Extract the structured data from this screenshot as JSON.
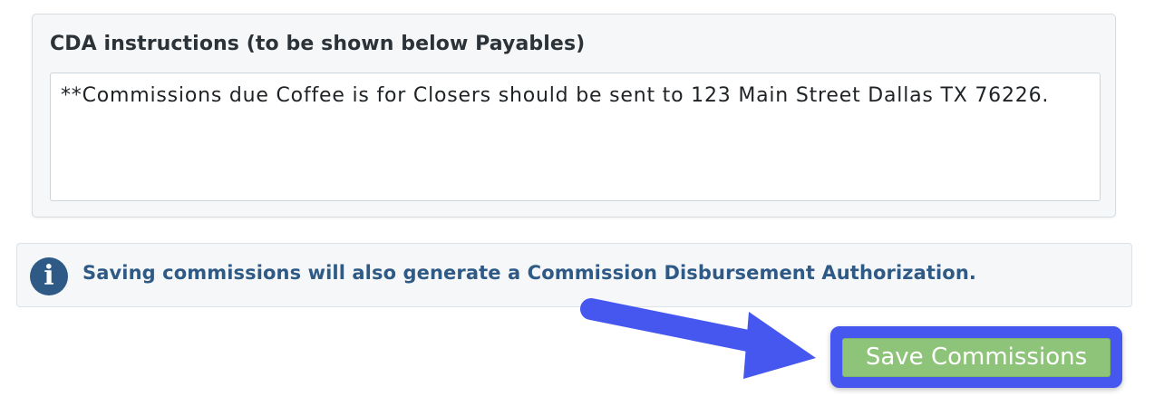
{
  "cda": {
    "label": "CDA instructions (to be shown below Payables)",
    "value": "**Commissions due Coffee is for Closers should be sent to 123 Main Street Dallas TX 76226."
  },
  "info_banner": {
    "icon": "info-icon",
    "icon_glyph": "i",
    "text": "Saving commissions will also generate a Commission Disbursement Authorization."
  },
  "actions": {
    "save_label": "Save Commissions"
  },
  "colors": {
    "accent_blue": "#4657f0",
    "info_blue": "#2f5a86",
    "save_green": "#8ec47a"
  }
}
